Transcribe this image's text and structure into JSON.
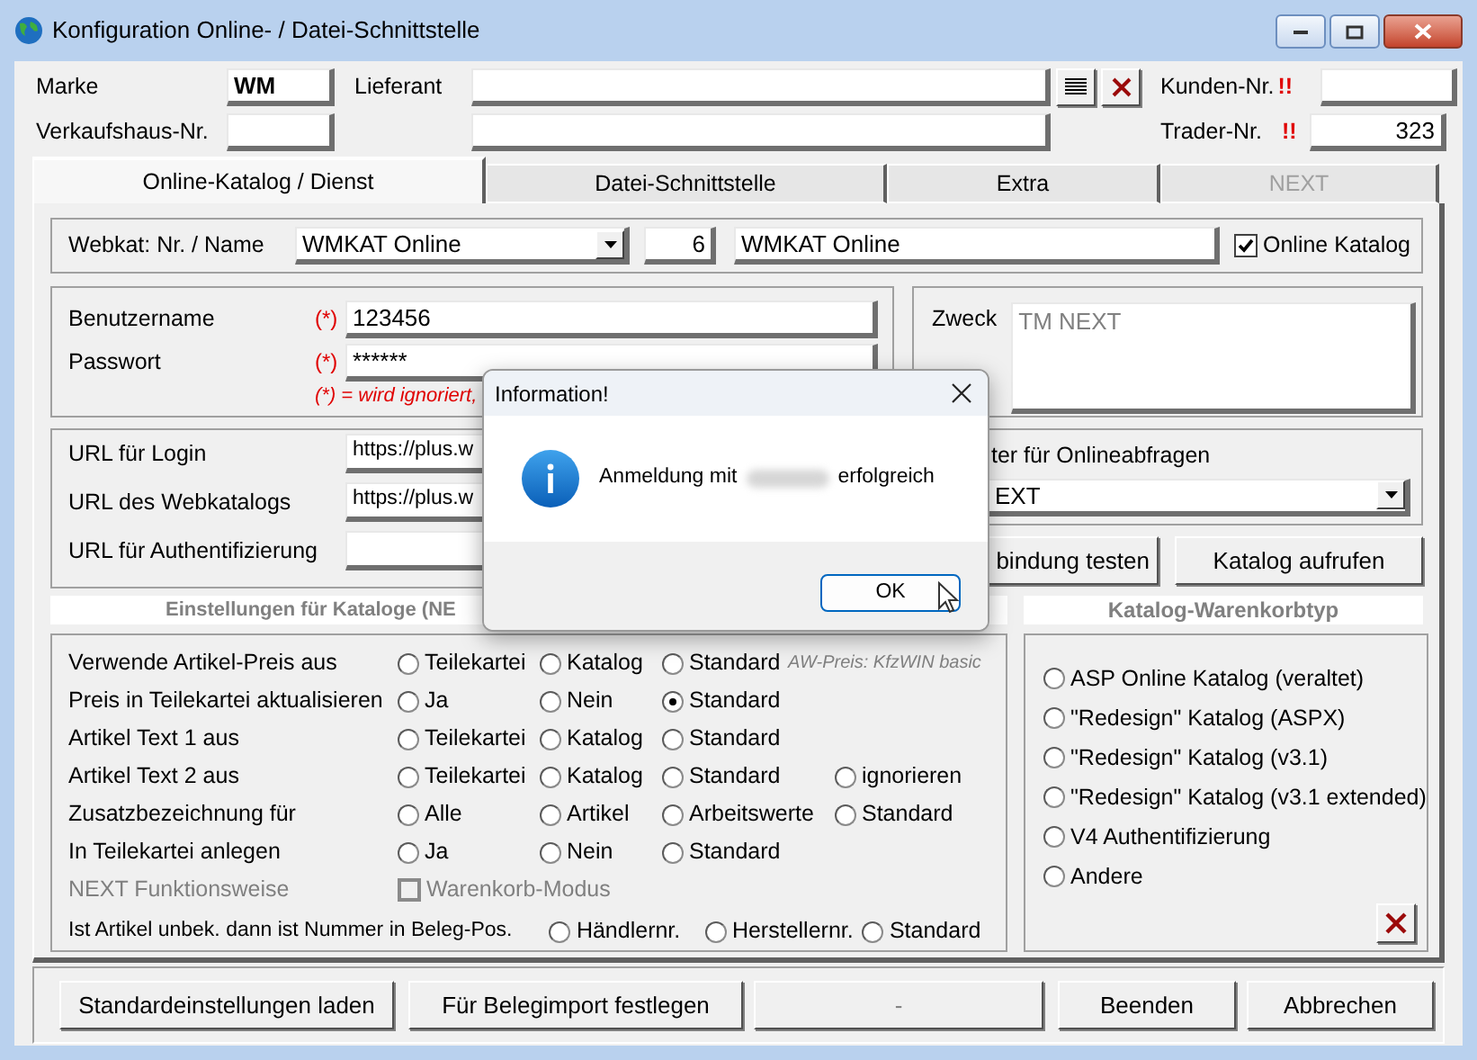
{
  "window": {
    "title": "Konfiguration Online- / Datei-Schnittstelle"
  },
  "header": {
    "marke": {
      "label": "Marke",
      "value": "WM"
    },
    "verkaufshaus": {
      "label": "Verkaufshaus-Nr."
    },
    "lieferant": {
      "label": "Lieferant"
    },
    "kunden": {
      "label": "Kunden-Nr.",
      "alert": "!!"
    },
    "trader": {
      "label": "Trader-Nr.",
      "alert": "!!",
      "value": "323"
    }
  },
  "tabs": [
    {
      "label": "Online-Katalog / Dienst",
      "selected": true,
      "disabled": false
    },
    {
      "label": "Datei-Schnittstelle",
      "selected": false,
      "disabled": false
    },
    {
      "label": "Extra",
      "selected": false,
      "disabled": false
    },
    {
      "label": "NEXT",
      "selected": false,
      "disabled": true
    }
  ],
  "webkat": {
    "label": "Webkat: Nr. / Name",
    "combo": "WMKAT Online",
    "nr": "6",
    "name": "WMKAT Online",
    "online": {
      "label": "Online Katalog",
      "checked": true
    }
  },
  "credentials": {
    "fields": [
      {
        "label": "Benutzername",
        "mark": "(*)",
        "value": "123456"
      },
      {
        "label": "Passwort",
        "mark": "(*)",
        "value": "******"
      }
    ],
    "hint": "(*) = wird ignoriert,"
  },
  "zweck": {
    "label": "Zweck",
    "value": "TM NEXT"
  },
  "urls": [
    {
      "label": "URL für Login",
      "value": "https://plus.w"
    },
    {
      "label": "URL des Webkatalogs",
      "value": "https://plus.w"
    },
    {
      "label": "URL für Authentifizierung"
    }
  ],
  "adapter": {
    "label": "ter für Onlineabfragen",
    "value": "EXT"
  },
  "actions": [
    {
      "label": "bindung testen"
    },
    {
      "label": "Katalog aufrufen"
    }
  ],
  "settings": {
    "title": "Einstellungen für Kataloge (NE",
    "rows": [
      {
        "kind": "radio",
        "label": "Verwende Artikel-Preis aus",
        "options": [
          {
            "label": "Teilekartei",
            "selected": false
          },
          {
            "label": "Katalog",
            "selected": false
          },
          {
            "label": "Standard",
            "selected": false
          }
        ],
        "note": "AW-Preis: KfzWIN basic"
      },
      {
        "kind": "radio",
        "label": "Preis in Teilekartei aktualisieren",
        "options": [
          {
            "label": "Ja",
            "selected": false
          },
          {
            "label": "Nein",
            "selected": false
          },
          {
            "label": "Standard",
            "selected": true
          }
        ]
      },
      {
        "kind": "radio",
        "label": "Artikel Text 1 aus",
        "options": [
          {
            "label": "Teilekartei",
            "selected": false
          },
          {
            "label": "Katalog",
            "selected": false
          },
          {
            "label": "Standard",
            "selected": false
          }
        ]
      },
      {
        "kind": "radio",
        "label": "Artikel Text 2 aus",
        "options": [
          {
            "label": "Teilekartei",
            "selected": false
          },
          {
            "label": "Katalog",
            "selected": false
          },
          {
            "label": "Standard",
            "selected": false
          },
          {
            "label": "ignorieren",
            "selected": false
          }
        ]
      },
      {
        "kind": "radio",
        "label": "Zusatzbezeichnung für",
        "options": [
          {
            "label": "Alle",
            "selected": false
          },
          {
            "label": "Artikel",
            "selected": false
          },
          {
            "label": "Arbeitswerte",
            "selected": false
          },
          {
            "label": "Standard",
            "selected": false
          }
        ]
      },
      {
        "kind": "radio",
        "label": "In Teilekartei anlegen",
        "options": [
          {
            "label": "Ja",
            "selected": false
          },
          {
            "label": "Nein",
            "selected": false
          },
          {
            "label": "Standard",
            "selected": false
          }
        ]
      },
      {
        "kind": "checkbox",
        "label": "NEXT Funktionsweise",
        "disabled": true,
        "checkbox": {
          "label": "Warenkorb-Modus",
          "checked": false
        }
      },
      {
        "kind": "inline",
        "label": "Ist Artikel unbek. dann ist Nummer in Beleg-Pos.",
        "options": [
          {
            "label": "Händlernr.",
            "selected": false
          },
          {
            "label": "Herstellernr.",
            "selected": false
          },
          {
            "label": "Standard",
            "selected": false
          }
        ]
      }
    ]
  },
  "warenkorb": {
    "title": "Katalog-Warenkorbtyp",
    "options": [
      {
        "label": "ASP Online Katalog (veraltet)",
        "selected": false
      },
      {
        "label": "\"Redesign\" Katalog (ASPX)",
        "selected": false
      },
      {
        "label": "\"Redesign\" Katalog (v3.1)",
        "selected": false
      },
      {
        "label": "\"Redesign\" Katalog (v3.1 extended)",
        "selected": false
      },
      {
        "label": "V4 Authentifizierung",
        "selected": false
      },
      {
        "label": "Andere",
        "selected": false
      }
    ]
  },
  "footer": [
    {
      "label": "Standardeinstellungen laden",
      "disabled": false
    },
    {
      "label": "Für Belegimport festlegen",
      "disabled": false
    },
    {
      "label": "-",
      "disabled": true
    },
    {
      "label": "Beenden",
      "disabled": false
    },
    {
      "label": "Abbrechen",
      "disabled": false
    }
  ],
  "dialog": {
    "title": "Information!",
    "message_before": "Anmeldung mit",
    "message_after": "erfolgreich",
    "ok": "OK"
  }
}
